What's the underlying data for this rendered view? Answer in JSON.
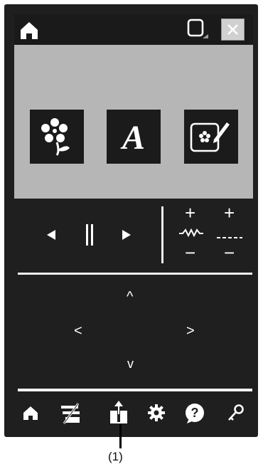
{
  "titlebar": {
    "home_icon": "home-icon",
    "frame_icon": "frame-select-icon",
    "close_icon": "close-icon"
  },
  "canvas": {
    "tiles": [
      {
        "name": "flower-pattern-tile",
        "icon": "flower-icon"
      },
      {
        "name": "character-tile",
        "icon": "script-a-icon",
        "glyph": "A"
      },
      {
        "name": "custom-design-tile",
        "icon": "pen-edit-icon"
      }
    ]
  },
  "controls": {
    "prev_icon": "triangle-left-icon",
    "pause_icon": "pause-icon",
    "next_icon": "triangle-right-icon",
    "stitch_width_icon": "zigzag-stitch-icon",
    "stitch_length_icon": "dashed-stitch-icon",
    "plus": "+",
    "minus": "−"
  },
  "navpad": {
    "up": "^",
    "left": "<",
    "right": ">",
    "down": "v"
  },
  "bottombar": {
    "icons": [
      "home-icon",
      "thread-tension-icon",
      "upload-icon",
      "settings-gear-icon",
      "help-icon",
      "key-icon"
    ],
    "help_glyph": "?"
  },
  "callout": {
    "label": "(1)"
  }
}
